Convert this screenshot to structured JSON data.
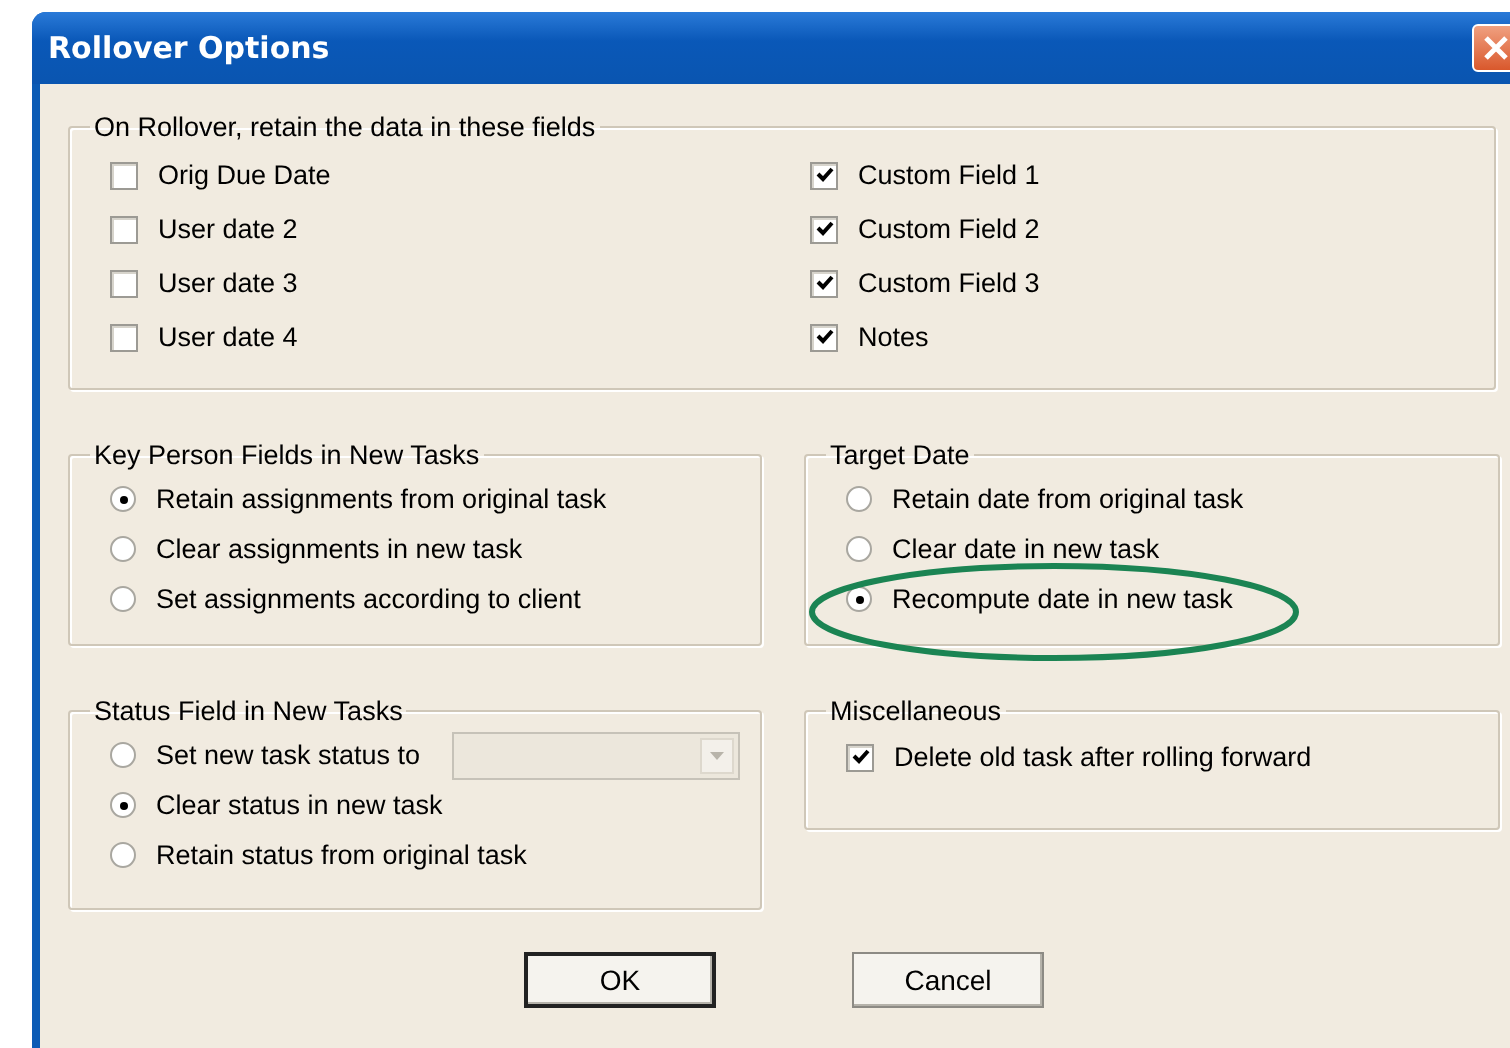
{
  "window": {
    "title": "Rollover Options"
  },
  "retain_fields": {
    "title": "On Rollover, retain the data in these fields",
    "options": [
      {
        "label": "Orig Due Date",
        "checked": false
      },
      {
        "label": "User date 2",
        "checked": false
      },
      {
        "label": "User date 3",
        "checked": false
      },
      {
        "label": "User date 4",
        "checked": false
      },
      {
        "label": "Custom Field 1",
        "checked": true
      },
      {
        "label": "Custom Field 2",
        "checked": true
      },
      {
        "label": "Custom Field 3",
        "checked": true
      },
      {
        "label": "Notes",
        "checked": true
      }
    ]
  },
  "key_person": {
    "title": "Key Person Fields in New Tasks",
    "options": [
      {
        "label": "Retain assignments from original task",
        "selected": true
      },
      {
        "label": "Clear assignments in new task",
        "selected": false
      },
      {
        "label": "Set assignments according to client",
        "selected": false
      }
    ]
  },
  "target_date": {
    "title": "Target Date",
    "options": [
      {
        "label": "Retain date from original task",
        "selected": false
      },
      {
        "label": "Clear date in new task",
        "selected": false
      },
      {
        "label": "Recompute date in new task",
        "selected": true
      }
    ]
  },
  "status_field": {
    "title": "Status Field in New Tasks",
    "options": [
      {
        "label": "Set new task status to",
        "selected": false,
        "kind": "dropdown"
      },
      {
        "label": "Clear status in new task",
        "selected": true,
        "kind": "plain"
      },
      {
        "label": "Retain status from original task",
        "selected": false,
        "kind": "plain"
      }
    ]
  },
  "miscellaneous": {
    "title": "Miscellaneous",
    "options": [
      {
        "label": "Delete old task after rolling forward",
        "checked": true
      }
    ]
  },
  "buttons": [
    {
      "label": "OK",
      "default": true
    },
    {
      "label": "Cancel",
      "default": false
    }
  ],
  "annotation": {
    "kind": "ellipse"
  }
}
